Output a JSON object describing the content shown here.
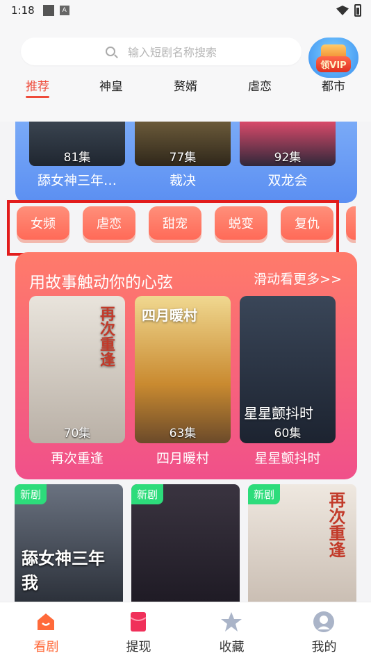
{
  "status_bar": {
    "time": "1:18",
    "a_badge": "A"
  },
  "search": {
    "placeholder": "输入短剧名称搜索",
    "vip_label": "领VIP"
  },
  "tabs": [
    "推荐",
    "神皇",
    "赘婿",
    "虐恋",
    "都市"
  ],
  "top_row": [
    {
      "title": "舔女神三年…",
      "episodes": "81集"
    },
    {
      "title": "裁决",
      "episodes": "77集"
    },
    {
      "title": "双龙会",
      "episodes": "92集"
    }
  ],
  "genres": [
    "女频",
    "虐恋",
    "甜宠",
    "蜕变",
    "复仇"
  ],
  "story_section": {
    "heading": "用故事触动你的心弦",
    "more": "滑动看更多>>",
    "items": [
      {
        "title": "再次重逢",
        "episodes": "70集",
        "art_text": "再次重逢"
      },
      {
        "title": "四月暖村",
        "episodes": "63集",
        "art_text": "四月暖村"
      },
      {
        "title": "星星颤抖时",
        "episodes": "60集",
        "art_text": "星星颤抖时"
      }
    ]
  },
  "new_dramas": {
    "badge": "新剧",
    "items": [
      {
        "art_text": "舔女神三年 我"
      },
      {
        "art_text": ""
      },
      {
        "art_text": "再次重逢"
      }
    ]
  },
  "bottom_nav": [
    "看剧",
    "提现",
    "收藏",
    "我的"
  ],
  "colors": {
    "accent": "#ee4b3a",
    "story_gradient_top": "#ff7b6a",
    "story_gradient_bottom": "#f0508a",
    "highlight_box": "#e21c1c",
    "new_badge": "#2ddc7b"
  }
}
